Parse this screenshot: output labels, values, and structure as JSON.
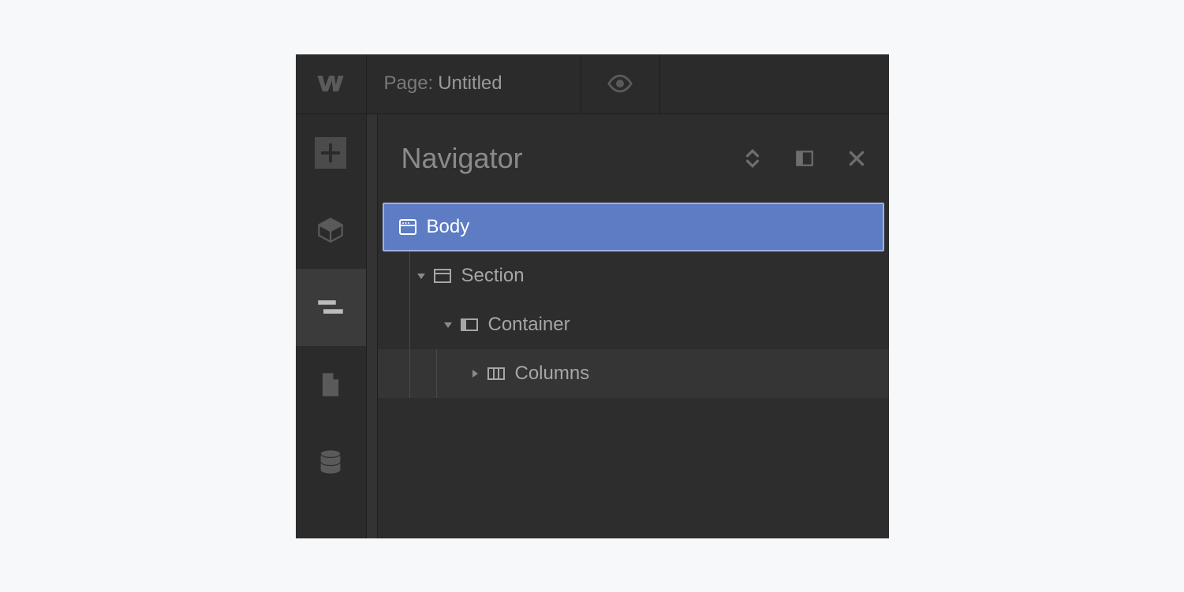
{
  "topbar": {
    "page_label_prefix": "Page:",
    "page_title": "Untitled"
  },
  "panel": {
    "title": "Navigator"
  },
  "tree": {
    "items": [
      {
        "label": "Body",
        "depth": 0,
        "expanded": true,
        "selected": true,
        "icon": "body"
      },
      {
        "label": "Section",
        "depth": 1,
        "expanded": true,
        "selected": false,
        "icon": "section"
      },
      {
        "label": "Container",
        "depth": 2,
        "expanded": true,
        "selected": false,
        "icon": "container"
      },
      {
        "label": "Columns",
        "depth": 3,
        "expanded": false,
        "selected": false,
        "icon": "columns",
        "hover": true
      }
    ]
  }
}
